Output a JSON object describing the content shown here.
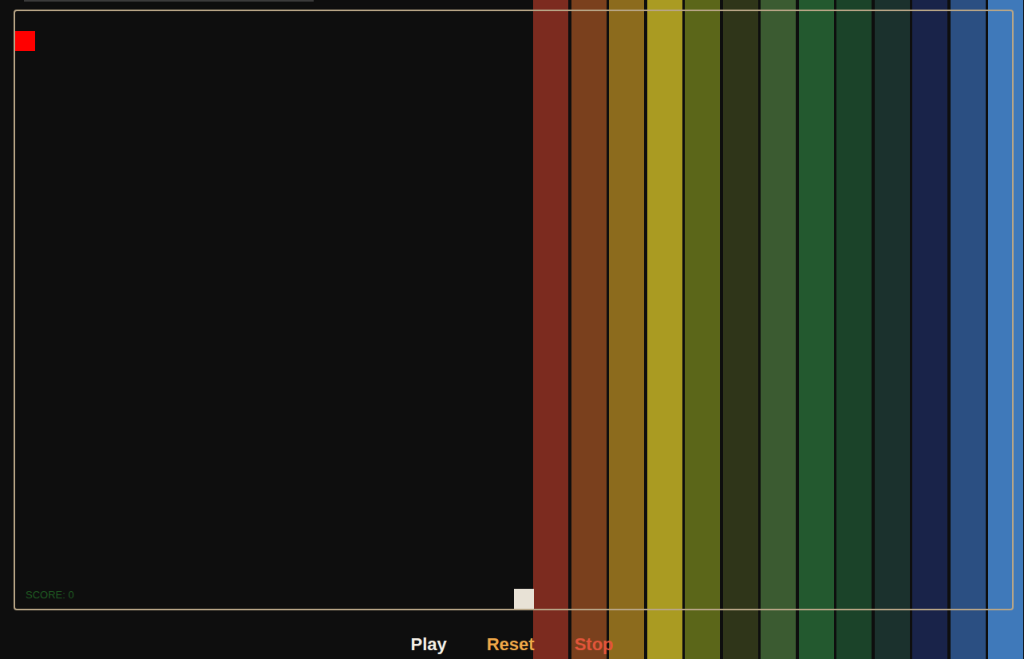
{
  "game": {
    "score_label": "SCORE: 0"
  },
  "controls": [
    {
      "label": "Play",
      "color": "#f4efe6"
    },
    {
      "label": "Reset",
      "color": "#f0a848"
    },
    {
      "label": "Stop",
      "color": "#e2553a"
    }
  ],
  "stripes": [
    {
      "color": "#7c2b1f"
    },
    {
      "color": "#7a401d"
    },
    {
      "color": "#8c6b1d"
    },
    {
      "color": "#aa9b22"
    },
    {
      "color": "#5b6619"
    },
    {
      "color": "#2f3519"
    },
    {
      "color": "#3b5b31"
    },
    {
      "color": "#23592f"
    },
    {
      "color": "#1b4329"
    },
    {
      "color": "#1b312d"
    },
    {
      "color": "#192349"
    },
    {
      "color": "#2b4f82"
    },
    {
      "color": "#3f79ba"
    }
  ]
}
